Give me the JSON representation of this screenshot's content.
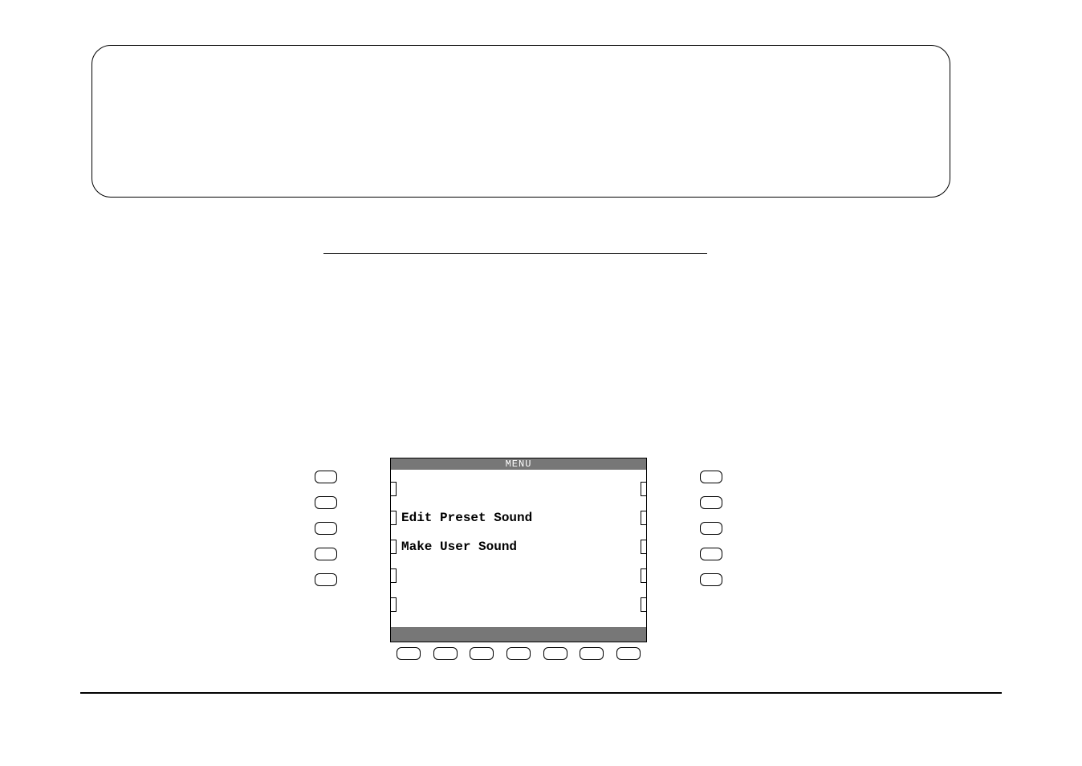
{
  "lcd": {
    "title": "MENU",
    "rows": [
      {
        "label": ""
      },
      {
        "label": "Edit Preset Sound"
      },
      {
        "label": "Make User Sound"
      },
      {
        "label": ""
      },
      {
        "label": ""
      }
    ]
  }
}
